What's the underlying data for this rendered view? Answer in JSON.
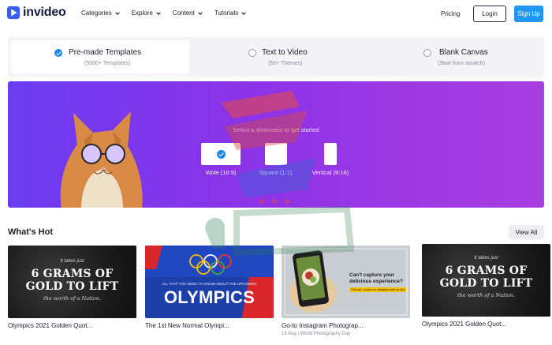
{
  "nav": {
    "logo_text": "invideo",
    "menu": [
      {
        "label": "Categories"
      },
      {
        "label": "Explore"
      },
      {
        "label": "Content"
      },
      {
        "label": "Tutorials"
      }
    ],
    "pricing": "Pricing",
    "login": "Login",
    "signup": "Sign Up"
  },
  "tabs": [
    {
      "title": "Pre-made Templates",
      "sub": "(5000+ Templates)",
      "selected": true
    },
    {
      "title": "Text to Video",
      "sub": "(50+ Themes)",
      "selected": false
    },
    {
      "title": "Blank Canvas",
      "sub": "(Start from scratch)",
      "selected": false
    }
  ],
  "hero": {
    "prompt": "Select a dimension to get started",
    "dimensions": [
      {
        "label": "Wide (16:9)",
        "selected": true
      },
      {
        "label": "Square (1:1)",
        "selected": false
      },
      {
        "label": "Vertical (9:16)",
        "selected": false
      }
    ]
  },
  "hot": {
    "title": "What's Hot",
    "view_all": "View All",
    "cards": [
      {
        "title": "Olympics 2021 Golden Quot...",
        "sub": "",
        "thumb": {
          "small": "It takes just",
          "big1": "6 GRAMS OF",
          "big2": "GOLD TO LIFT",
          "tail": "the worth of a Nation."
        }
      },
      {
        "title": "The 1st New Normal Olympi...",
        "sub": "",
        "thumb": {
          "small": "ALL THAT YOU NEED TO KNOW ABOUT THE UPCOMING",
          "big": "OLYMPICS"
        }
      },
      {
        "title": "Go-to Instagram Photograp...",
        "sub": "19 Aug | World Photography Day",
        "thumb": {
          "q1": "Can't capture your",
          "q2": "delicious experience?",
          "tag": "Find out... photos on Instagram with our tips"
        }
      },
      {
        "title": "Olympics 2021 Golden Quot...",
        "sub": "",
        "thumb": {
          "small": "It takes just",
          "big1": "6 GRAMS OF",
          "big2": "GOLD TO LIFT",
          "tail": "the worth of a Nation."
        }
      }
    ]
  },
  "colors": {
    "accent": "#2196f3",
    "hero_start": "#6a3cf0",
    "hero_end": "#a93ee0"
  }
}
